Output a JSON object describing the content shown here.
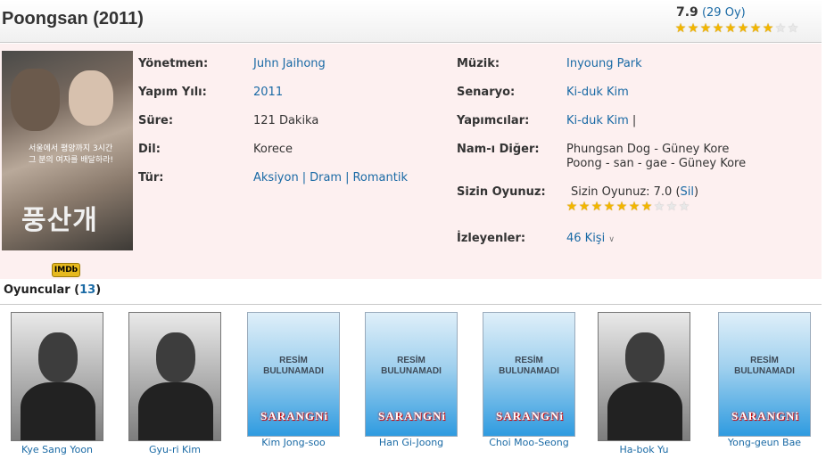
{
  "movie": {
    "title": "Poongsan (2011)",
    "rating": "7.9",
    "votes": "29 Oy",
    "rating_stars": 8,
    "rating_stars_total": 10
  },
  "poster": {
    "tagline_line1": "서울에서 평양까지 3시간",
    "tagline_line2": "그 분의 여자를 배달하라!",
    "title_text": "풍산개",
    "imdb_label": "IMDb"
  },
  "details": {
    "director_label": "Yönetmen:",
    "director": "Juhn Jaihong",
    "year_label": "Yapım Yılı:",
    "year": "2011",
    "duration_label": "Süre:",
    "duration": "121 Dakika",
    "language_label": "Dil:",
    "language": "Korece",
    "genre_label": "Tür:",
    "genres": [
      "Aksiyon",
      "Dram",
      "Romantik"
    ],
    "music_label": "Müzik:",
    "music": "Inyoung Park",
    "screenplay_label": "Senaryo:",
    "screenplay": "Ki-duk Kim",
    "producers_label": "Yapımcılar:",
    "producers": "Ki-duk Kim",
    "producers_sep": "|",
    "aka_label": "Nam-ı Diğer:",
    "aka_line1": "Phungsan Dog - Güney Kore",
    "aka_line2": "Poong - san - gae - Güney Kore",
    "your_rating_label": "Sizin Oyunuz:",
    "your_rating_text": "Sizin Oyunuz: 7.0 (",
    "your_rating_delete": "Sil",
    "your_rating_close": ")",
    "your_rating_stars": 7,
    "watchers_label": "İzleyenler:",
    "watchers": "46 Kişi",
    "watchers_icon": "chevron-down-icon"
  },
  "cast": {
    "heading": "Oyuncular (",
    "count": "13",
    "heading_close": ")",
    "placeholder_line1": "RESİM",
    "placeholder_line2": "BULUNAMADI",
    "placeholder_logo": "SARANGNi",
    "members": [
      {
        "name": "Kye Sang Yoon",
        "photo": "real"
      },
      {
        "name": "Gyu-ri Kim",
        "photo": "real"
      },
      {
        "name": "Kim Jong-soo",
        "photo": "placeholder"
      },
      {
        "name": "Han Gi-Joong",
        "photo": "placeholder"
      },
      {
        "name": "Choi Moo-Seong",
        "photo": "placeholder"
      },
      {
        "name": "Ha-bok Yu",
        "photo": "real"
      },
      {
        "name": "Yong-geun Bae",
        "photo": "placeholder"
      }
    ]
  },
  "colors": {
    "link": "#1a6aa5",
    "info_background": "#fdf0f0",
    "star_on": "#f2b600"
  }
}
